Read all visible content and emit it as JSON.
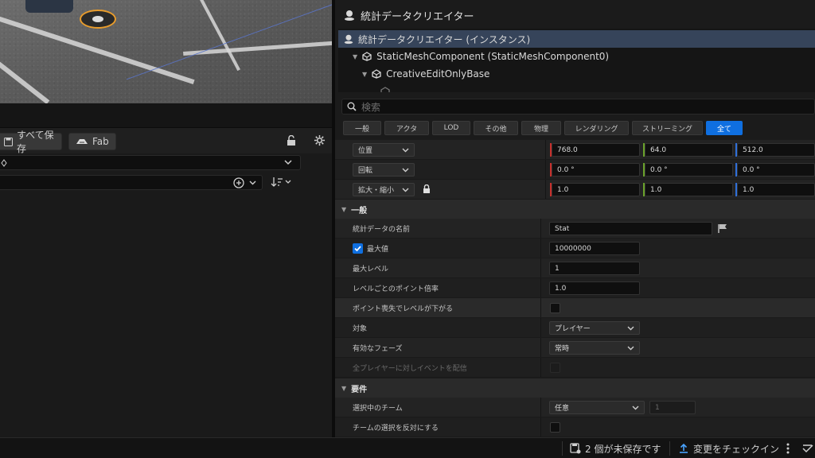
{
  "toolbar": {
    "save_all_label": "すべて保存",
    "fab_label": "Fab"
  },
  "details": {
    "title": "統計データクリエイター",
    "tree": [
      {
        "label": "統計データクリエイター (インスタンス)"
      },
      {
        "label": "StaticMeshComponent (StaticMeshComponent0)"
      },
      {
        "label": "CreativeEditOnlyBase"
      }
    ],
    "search_placeholder": "検索",
    "filters": [
      "一般",
      "アクタ",
      "LOD",
      "その他",
      "物理",
      "レンダリング",
      "ストリーミング",
      "全て"
    ],
    "active_filter": "全て",
    "transform": {
      "location": {
        "label": "位置",
        "x": "768.0",
        "y": "64.0",
        "z": "512.0"
      },
      "rotation": {
        "label": "回転",
        "x": "0.0 °",
        "y": "0.0 °",
        "z": "0.0 °"
      },
      "scale": {
        "label": "拡大・縮小",
        "x": "1.0",
        "y": "1.0",
        "z": "1.0"
      }
    },
    "general": {
      "header": "一般",
      "stat_name_label": "統計データの名前",
      "stat_name_value": "Stat",
      "max_value_label": "最大値",
      "max_value_value": "10000000",
      "max_level_label": "最大レベル",
      "max_level_value": "1",
      "points_per_level_label": "レベルごとのポイント倍率",
      "points_per_level_value": "1.0",
      "level_down_label": "ポイント喪失でレベルが下がる",
      "target_label": "対象",
      "target_value": "プレイヤー",
      "phase_label": "有効なフェーズ",
      "phase_value": "常時",
      "broadcast_label": "全プレイヤーに対しイベントを配信"
    },
    "requirements": {
      "header": "要件",
      "team_label": "選択中のチーム",
      "team_value": "任意",
      "team_index": "1",
      "invert_label": "チームの選択を反対にする"
    }
  },
  "statusbar": {
    "unsaved": "2 個が未保存です",
    "checkin": "変更をチェックイン"
  },
  "colors": {
    "accent": "#0f6fe0",
    "axis_x": "#c8302c",
    "axis_y": "#6aa22a",
    "axis_z": "#2f6fd8"
  }
}
